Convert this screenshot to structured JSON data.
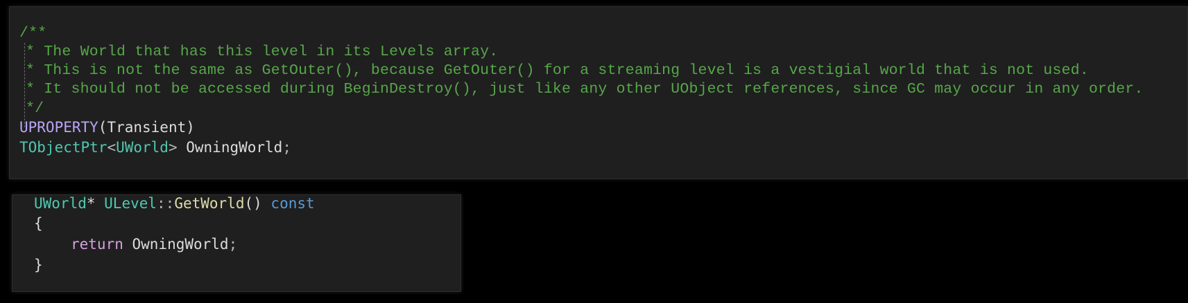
{
  "comment_block": {
    "open": "/**",
    "line1": "* The World that has this level in its Levels array.",
    "line2": "* This is not the same as GetOuter(), because GetOuter() for a streaming level is a vestigial world that is not used.",
    "line3": "* It should not be accessed during BeginDestroy(), just like any other UObject references, since GC may occur in any order.",
    "close": "*/"
  },
  "declaration": {
    "macro": "UPROPERTY",
    "macro_args": "(Transient)",
    "template_type": "TObjectPtr",
    "open_angle": "<",
    "inner_type": "UWorld",
    "close_angle": ">",
    "variable": " OwningWorld",
    "semicolon": ";"
  },
  "function": {
    "return_type": "UWorld",
    "pointer": "* ",
    "class_name": "ULevel",
    "scope": "::",
    "method": "GetWorld",
    "parens": "()",
    "qualifier": "const",
    "open_brace": "{",
    "return_keyword": "return",
    "return_value": " OwningWorld",
    "semicolon": ";",
    "close_brace": "}"
  },
  "colors": {
    "background": "#000000",
    "panel": "#1f1f1f",
    "comment": "#57a64a",
    "macro": "#b8a6f5",
    "type": "#4ec9b0",
    "function": "#dcdcaa",
    "keyword": "#569cd6",
    "control_keyword": "#d8a0df",
    "identifier": "#dcdcdc"
  }
}
